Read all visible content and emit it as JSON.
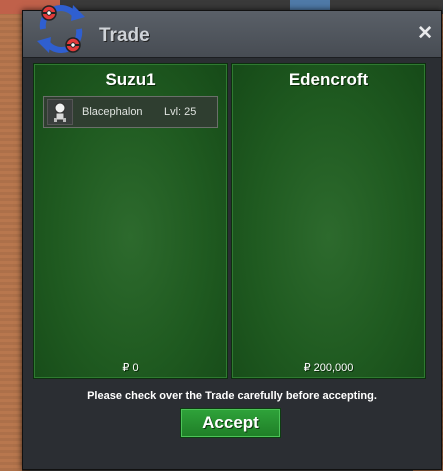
{
  "window": {
    "title": "Trade",
    "close_glyph": "✕"
  },
  "left_trader": {
    "name": "Suzu1",
    "items": [
      {
        "name": "Blacephalon",
        "level": "Lvl: 25",
        "icon": "blacephalon-sprite-icon"
      }
    ],
    "money": "₽ 0"
  },
  "right_trader": {
    "name": "Edencroft",
    "items": [],
    "money": "₽ 200,000"
  },
  "notice": "Please check over the Trade carefully before accepting.",
  "accept_label": "Accept",
  "colors": {
    "panel_green": "#1f5a20",
    "accept_green": "#2fa33a",
    "titlebar": "#4f555c"
  }
}
